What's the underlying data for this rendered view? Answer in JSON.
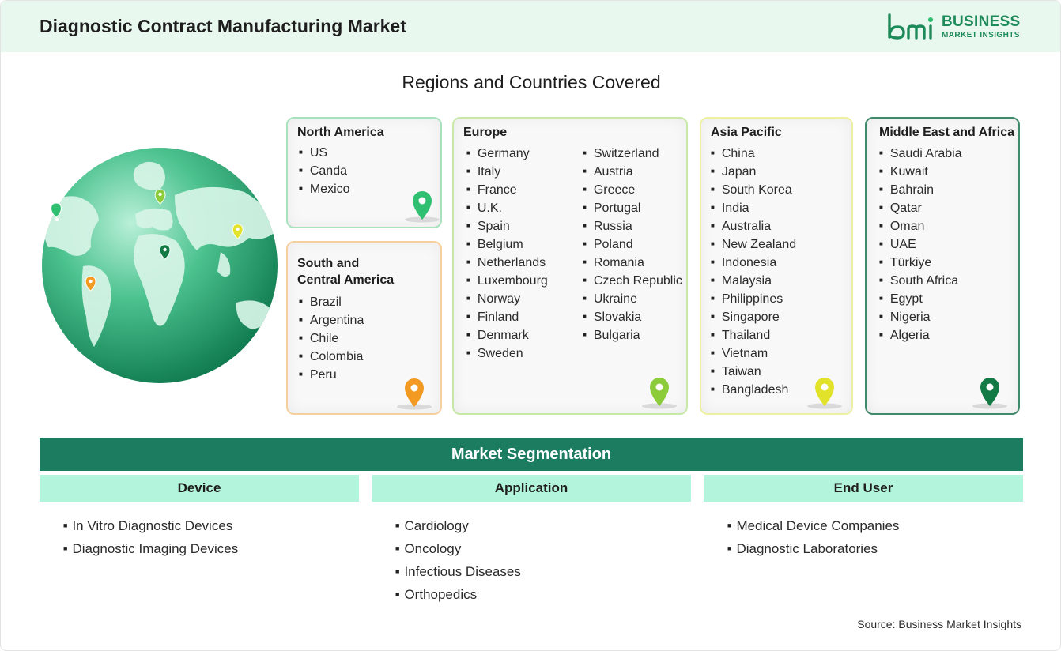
{
  "header": {
    "title": "Diagnostic Contract Manufacturing Market",
    "logo_mark": "bmi",
    "logo_line1": "BUSINESS",
    "logo_line2": "MARKET INSIGHTS"
  },
  "regions_title": "Regions and Countries Covered",
  "regions": {
    "north_america": {
      "title": "North America",
      "pin_color": "#2fbf71",
      "countries": [
        "US",
        "Canda",
        "Mexico"
      ]
    },
    "south_central_america": {
      "title_line1": "South and",
      "title_line2": "Central America",
      "pin_color": "#f29a21",
      "countries": [
        "Brazil",
        "Argentina",
        "Chile",
        "Colombia",
        "Peru"
      ]
    },
    "europe": {
      "title": "Europe",
      "pin_color": "#8ccc3a",
      "countries_col1": [
        "Germany",
        "Italy",
        "France",
        "U.K.",
        "Spain",
        "Belgium",
        "Netherlands",
        "Luxembourg",
        "Norway",
        "Finland",
        "Denmark",
        "Sweden"
      ],
      "countries_col2": [
        "Switzerland",
        "Austria",
        "Greece",
        "Portugal",
        "Russia",
        "Poland",
        "Romania",
        "Czech Republic",
        "Ukraine",
        "Slovakia",
        "Bulgaria"
      ]
    },
    "asia_pacific": {
      "title": "Asia Pacific",
      "pin_color": "#e2e22a",
      "countries": [
        "China",
        "Japan",
        "South Korea",
        "India",
        "Australia",
        "New Zealand",
        "Indonesia",
        "Malaysia",
        "Philippines",
        "Singapore",
        "Thailand",
        "Vietnam",
        "Taiwan",
        "Bangladesh"
      ]
    },
    "middle_east_africa": {
      "title": "Middle East and Africa",
      "pin_color": "#137a45",
      "countries": [
        "Saudi Arabia",
        "Kuwait",
        "Bahrain",
        "Qatar",
        "Oman",
        "UAE",
        "Türkiye",
        "South Africa",
        "Egypt",
        "Nigeria",
        "Algeria"
      ]
    }
  },
  "segmentation": {
    "title": "Market Segmentation",
    "columns": [
      {
        "heading": "Device",
        "items": [
          "In Vitro Diagnostic Devices",
          "Diagnostic Imaging Devices"
        ]
      },
      {
        "heading": "Application",
        "items": [
          "Cardiology",
          "Oncology",
          "Infectious Diseases",
          "Orthopedics"
        ]
      },
      {
        "heading": "End User",
        "items": [
          "Medical Device Companies",
          "Diagnostic Laboratories"
        ]
      }
    ]
  },
  "source": "Source: Business Market Insights",
  "colors": {
    "brand_green": "#1d8a5a",
    "segment_bar": "#1b7c5f",
    "segment_head": "#b3f4dc",
    "header_bg": "#e9f8ef"
  }
}
